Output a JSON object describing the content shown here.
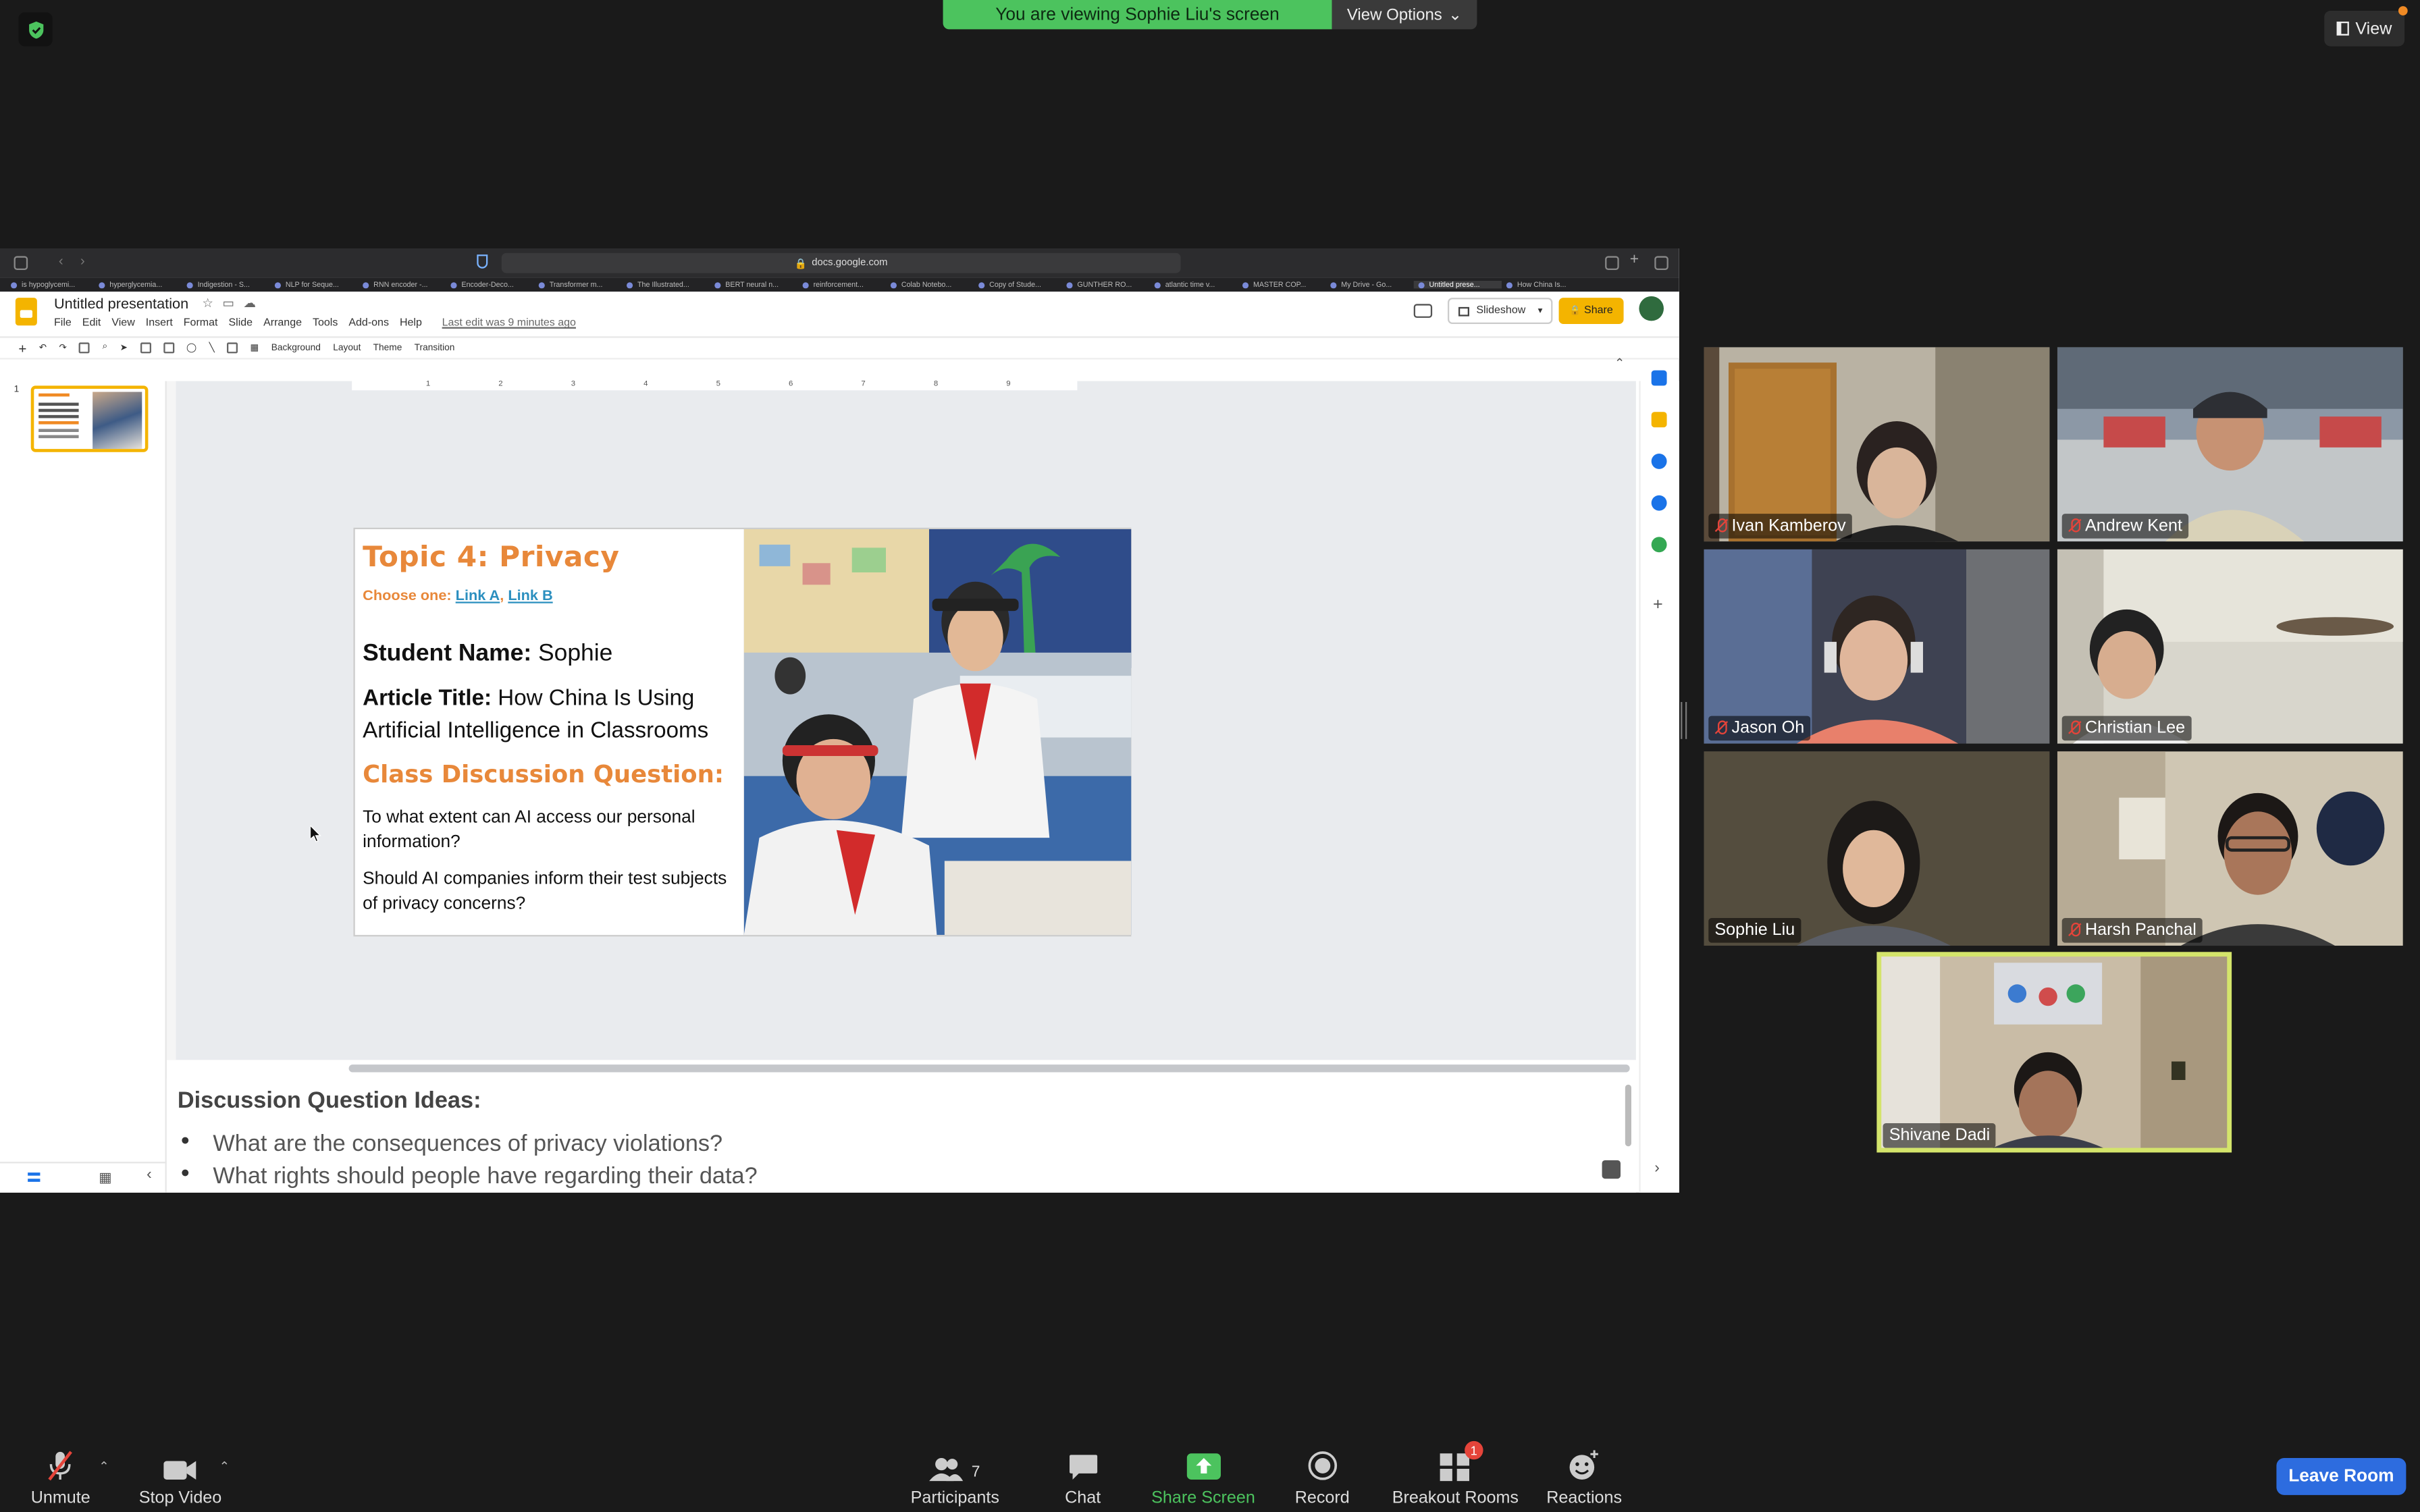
{
  "zoom": {
    "banner_text": "You are viewing Sophie Liu's screen",
    "view_options_label": "View Options",
    "view_label": "View",
    "leave_label": "Leave Room",
    "toolbar": [
      {
        "label": "Unmute",
        "icon": "mic-off-icon"
      },
      {
        "label": "Stop Video",
        "icon": "video-icon"
      },
      {
        "label": "Participants",
        "icon": "participants-icon",
        "count": "7"
      },
      {
        "label": "Chat",
        "icon": "chat-icon"
      },
      {
        "label": "Share Screen",
        "icon": "share-screen-icon"
      },
      {
        "label": "Record",
        "icon": "record-icon"
      },
      {
        "label": "Breakout Rooms",
        "icon": "breakout-rooms-icon",
        "badge": "1"
      },
      {
        "label": "Reactions",
        "icon": "reactions-icon"
      }
    ],
    "participants": [
      {
        "name": "Ivan Kamberov",
        "muted": true
      },
      {
        "name": "Andrew Kent",
        "muted": true
      },
      {
        "name": "Jason Oh",
        "muted": true
      },
      {
        "name": "Christian Lee",
        "muted": true
      },
      {
        "name": "Sophie Liu",
        "muted": false
      },
      {
        "name": "Harsh Panchal",
        "muted": true
      },
      {
        "name": "Shivane Dadi",
        "muted": false,
        "speaking": true
      }
    ]
  },
  "browser": {
    "url": "docs.google.com",
    "tabs": [
      "is hypoglycemi...",
      "hyperglycemia...",
      "Indigestion - S...",
      "NLP for Seque...",
      "RNN encoder -...",
      "Encoder-Deco...",
      "Transformer m...",
      "The Illustrated...",
      "BERT neural n...",
      "reinforcement...",
      "Colab Notebo...",
      "Copy of Stude...",
      "GUNTHER RO...",
      "atlantic time v...",
      "MASTER COP...",
      "My Drive - Go...",
      "Untitled prese...",
      "How China Is..."
    ]
  },
  "slides_app": {
    "doc_title": "Untitled presentation",
    "menu": [
      "File",
      "Edit",
      "View",
      "Insert",
      "Format",
      "Slide",
      "Arrange",
      "Tools",
      "Add-ons",
      "Help"
    ],
    "last_edit": "Last edit was 9 minutes ago",
    "slideshow_label": "Slideshow",
    "share_label": "Share",
    "toolbar": [
      "Background",
      "Layout",
      "Theme",
      "Transition"
    ],
    "slide_number": "1",
    "ruler_ticks": [
      "1",
      "2",
      "3",
      "4",
      "5",
      "6",
      "7",
      "8",
      "9"
    ]
  },
  "slide": {
    "title": "Topic  4: Privacy",
    "choose_prefix": "Choose one: ",
    "link_a": "Link A",
    "link_sep": ", ",
    "link_b": "Link B",
    "student_name_label": "Student Name:",
    "student_name": " Sophie",
    "article_label": "Article Title:",
    "article_title": " How China Is Using Artificial Intelligence in Classrooms",
    "discussion_heading": "Class Discussion Question:",
    "question_1": "To  what extent can AI access our personal information?",
    "question_2": "Should AI companies inform their test subjects of privacy concerns?"
  },
  "notes": {
    "heading": "Discussion Question Ideas:",
    "items": [
      "What are the consequences of privacy violations?",
      "What rights should people have regarding their data?"
    ]
  }
}
